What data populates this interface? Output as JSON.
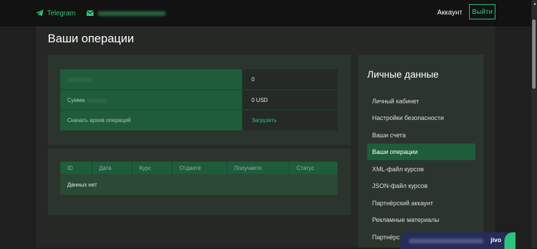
{
  "header": {
    "telegram_label": "Telegram",
    "account_label": "Аккаунт",
    "logout_label": "Выйти"
  },
  "page_title": "Ваши операции",
  "summary": {
    "row1_value": "0",
    "row2_label": "Сумма",
    "row2_value": "0 USD",
    "row3_label": "Скачать архив операций",
    "row3_link": "Загрузить"
  },
  "operations_table": {
    "headers": [
      "ID",
      "Дата",
      "Курс",
      "Отдаете",
      "Получаете",
      "Статус"
    ],
    "empty_text": "Данных нет"
  },
  "sidebar": {
    "title": "Личные данные",
    "items": [
      {
        "label": "Личный кабинет"
      },
      {
        "label": "Настройки безопасности"
      },
      {
        "label": "Ваши счета"
      },
      {
        "label": "Ваши операции",
        "active": true
      },
      {
        "label": "XML-файл курсов"
      },
      {
        "label": "JSON-файл курсов"
      },
      {
        "label": "Партнёрский аккаунт"
      },
      {
        "label": "Рекламные материалы"
      },
      {
        "label": "Партнёрс"
      }
    ]
  },
  "chat_widget": {
    "brand": "jivo"
  },
  "colors": {
    "accent": "#2ec27e",
    "dark_green": "#1f5c3c",
    "background": "#1e1f1e"
  }
}
